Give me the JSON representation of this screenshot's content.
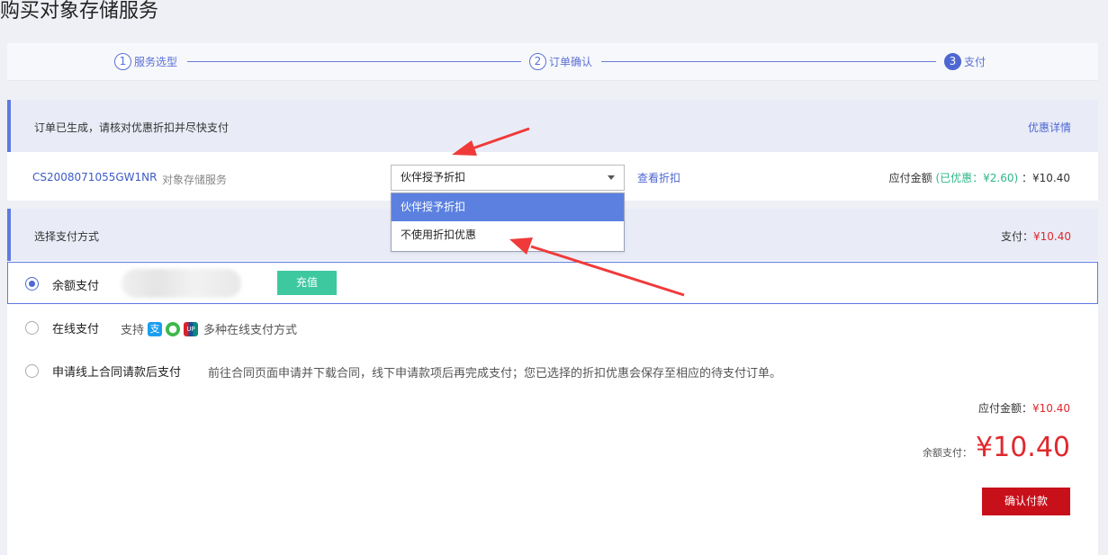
{
  "page": {
    "title": "购买对象存储服务"
  },
  "steps": [
    {
      "num": "1",
      "label": "服务选型"
    },
    {
      "num": "2",
      "label": "订单确认"
    },
    {
      "num": "3",
      "label": "支付"
    }
  ],
  "order": {
    "notice": "订单已生成，请核对优惠折扣并尽快支付",
    "discount_details_link": "优惠详情",
    "code": "CS2008071055GW1NR",
    "service": "对象存储服务",
    "discount_select": {
      "value": "伙伴授予折扣",
      "options": [
        "伙伴授予折扣",
        "不使用折扣优惠"
      ]
    },
    "view_discount_link": "查看折扣",
    "due_label": "应付金额",
    "discount_text": "(已优惠：¥2.60)",
    "due_amount": "：¥10.40"
  },
  "payment": {
    "section_title": "选择支付方式",
    "pay_label": "支付：",
    "pay_amount": "¥10.40",
    "balance": {
      "label": "余额支付",
      "recharge_button": "充值"
    },
    "online": {
      "label": "在线支付",
      "support_text": "支持",
      "icons": [
        "alipay-icon",
        "wechat-pay-icon",
        "unionpay-icon"
      ],
      "more_text": "多种在线支付方式"
    },
    "contract": {
      "label": "申请线上合同请款后支付",
      "desc": "前往合同页面申请并下载合同，线下申请款项后再完成支付；您已选择的折扣优惠会保存至相应的待支付订单。"
    },
    "summary_due_label": "应付金额：",
    "summary_due_amount": "¥10.40",
    "balance_pay_label": "余额支付：",
    "balance_pay_amount": "¥10.40",
    "confirm_button": "确认付款"
  },
  "colors": {
    "accent": "#4e67d2",
    "danger": "#e0282e",
    "success": "#3ec8a0",
    "confirm": "#c8101a",
    "annotation_arrow": "#f03a3a"
  }
}
